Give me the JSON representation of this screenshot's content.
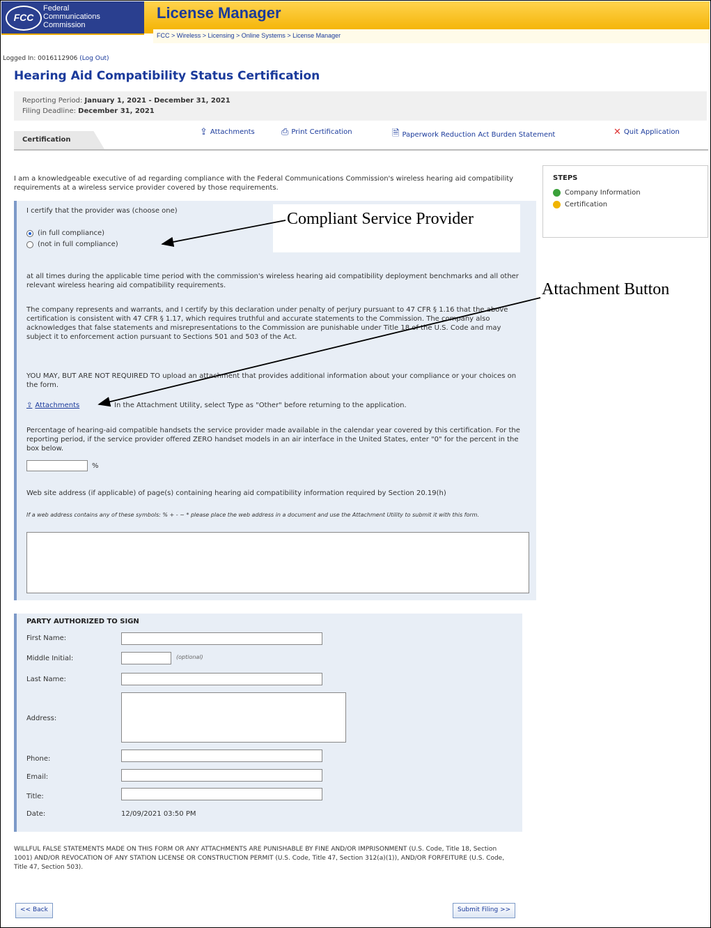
{
  "header": {
    "fcc_badge": "FCC",
    "agency_line1": "Federal",
    "agency_line2": "Communications",
    "agency_line3": "Commission",
    "app_title": "License Manager",
    "breadcrumb": "FCC > Wireless > Licensing > Online Systems > License Manager"
  },
  "session": {
    "logged_in_label": "Logged In: 0016112906",
    "logout_link": "(Log Out)"
  },
  "page_title": "Hearing Aid Compatibility Status Certification",
  "period": {
    "reporting_label": "Reporting Period:",
    "reporting_value": "January 1, 2021 - December 31, 2021",
    "deadline_label": "Filing Deadline:",
    "deadline_value": "December 31, 2021"
  },
  "tab": {
    "label": "Certification"
  },
  "toolbar": {
    "attachments": "Attachments",
    "print": "Print Certification",
    "paperwork": "Paperwork Reduction Act Burden Statement",
    "quit": "Quit Application"
  },
  "intro": "I am a knowledgeable executive of ad regarding compliance with the Federal Communications Commission's wireless hearing aid compatibility requirements at a wireless service provider covered by those requirements.",
  "steps": {
    "title": "STEPS",
    "items": [
      {
        "label": "Company Information",
        "status": "complete"
      },
      {
        "label": "Certification",
        "status": "current"
      }
    ]
  },
  "certify": {
    "prompt": "I certify that the provider was (choose one)",
    "option_full": "(in full compliance)",
    "option_not": "(not in full compliance)",
    "selected": "full",
    "p_times": "at all times during the applicable time period with the commission's wireless hearing aid compatibility deployment benchmarks and all other relevant wireless hearing aid compatibility requirements.",
    "p_represents": "The company represents and warrants, and I certify by this declaration under penalty of perjury pursuant to 47 CFR § 1.16 that the above certification is consistent with 47 CFR § 1.17, which requires truthful and accurate statements to the Commission. The company also acknowledges that false statements and misrepresentations to the Commission are punishable under Title 18 of the U.S. Code and may subject it to enforcement action pursuant to Sections 501 and 503 of the Act.",
    "p_may": "YOU MAY, BUT ARE NOT REQUIRED TO upload an attachment that provides additional information about your compliance or your choices on the form.",
    "attach_link": "Attachments",
    "attach_note": "In the Attachment Utility, select Type as \"Other\" before returning to the application.",
    "p_percentage": "Percentage of hearing-aid compatible handsets the service provider made available in the calendar year covered by this certification. For the reporting period, if the service provider offered ZERO handset models in an air interface in the United States, enter \"0\" for the percent in the box below.",
    "percent_sign": "%",
    "percent_value": "",
    "p_web": "Web site address (if applicable) of page(s) containing hearing aid compatibility information required by Section 20.19(h)",
    "p_web_note": "If a web address contains any of these symbols: % + - ~ * please place the web address in a document and use the Attachment Utility to submit it with this form.",
    "web_value": ""
  },
  "party": {
    "title": "PARTY AUTHORIZED TO SIGN",
    "first_name_label": "First Name:",
    "middle_label": "Middle Initial:",
    "middle_optional": "(optional)",
    "last_name_label": "Last Name:",
    "address_label": "Address:",
    "phone_label": "Phone:",
    "email_label": "Email:",
    "title_label": "Title:",
    "date_label": "Date:",
    "date_value": "12/09/2021 03:50 PM"
  },
  "warning": "WILLFUL FALSE STATEMENTS MADE ON THIS FORM OR ANY ATTACHMENTS ARE PUNISHABLE BY FINE AND/OR IMPRISONMENT (U.S. Code, Title 18, Section 1001) AND/OR REVOCATION OF ANY STATION LICENSE OR CONSTRUCTION PERMIT (U.S. Code, Title 47, Section 312(a)(1)), AND/OR FORFEITURE (U.S. Code, Title 47, Section 503).",
  "buttons": {
    "back": "<< Back",
    "submit": "Submit Filing >>"
  },
  "annotations": {
    "compliant": "Compliant Service Provider",
    "attachment": "Attachment Button"
  },
  "icons": {
    "attachments": "upload-icon",
    "print": "printer-icon",
    "paperwork": "document-icon",
    "quit": "close-icon",
    "step_done": "check-circle-icon",
    "step_current": "pending-circle-icon"
  },
  "colors": {
    "brand_blue": "#1a3a9b",
    "header_gold": "#f3b100",
    "panel": "#e8eef6"
  }
}
